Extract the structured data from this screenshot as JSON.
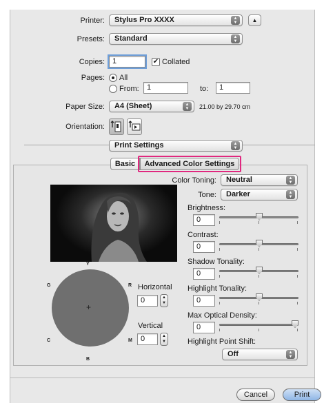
{
  "printer": {
    "label": "Printer:",
    "value": "Stylus Pro XXXX"
  },
  "presets": {
    "label": "Presets:",
    "value": "Standard"
  },
  "copies": {
    "label": "Copies:",
    "value": "1",
    "collated_label": "Collated",
    "collated_checked": true
  },
  "pages": {
    "label": "Pages:",
    "all_label": "All",
    "from_label": "From:",
    "from_value": "1",
    "to_label": "to:",
    "to_value": "1"
  },
  "paper_size": {
    "label": "Paper Size:",
    "value": "A4 (Sheet)",
    "dimensions": "21.00 by 29.70 cm"
  },
  "orientation": {
    "label": "Orientation:"
  },
  "section_popup": {
    "value": "Print Settings"
  },
  "tabs": [
    {
      "label": "Basic"
    },
    {
      "label": "Advanced Color Settings"
    }
  ],
  "highlight_color": "#e0287f",
  "color_toning": {
    "label": "Color Toning:",
    "value": "Neutral"
  },
  "tone": {
    "label": "Tone:",
    "value": "Darker"
  },
  "sliders": [
    {
      "label": "Brightness:",
      "value": "0",
      "level": 0.5
    },
    {
      "label": "Contrast:",
      "value": "0",
      "level": 0.5
    },
    {
      "label": "Shadow Tonality:",
      "value": "0",
      "level": 0.5
    },
    {
      "label": "Highlight Tonality:",
      "value": "0",
      "level": 0.5
    },
    {
      "label": "Max Optical Density:",
      "value": "0",
      "level": 1.0
    }
  ],
  "highlight_point_shift": {
    "label": "Highlight Point Shift:",
    "value": "Off"
  },
  "color_wheel": {
    "letters": {
      "top": "Y",
      "left_top": "G",
      "right_top": "R",
      "left_bottom": "C",
      "right_bottom": "M",
      "bottom": "B"
    },
    "center_mark": "+",
    "horizontal_label": "Horizontal",
    "horizontal_value": "0",
    "vertical_label": "Vertical",
    "vertical_value": "0"
  },
  "buttons": {
    "cancel": "Cancel",
    "print": "Print"
  },
  "icons": {
    "disclosure": "disclosure-triangle-icon",
    "portrait": "portrait-orientation-icon",
    "landscape": "landscape-orientation-icon"
  }
}
